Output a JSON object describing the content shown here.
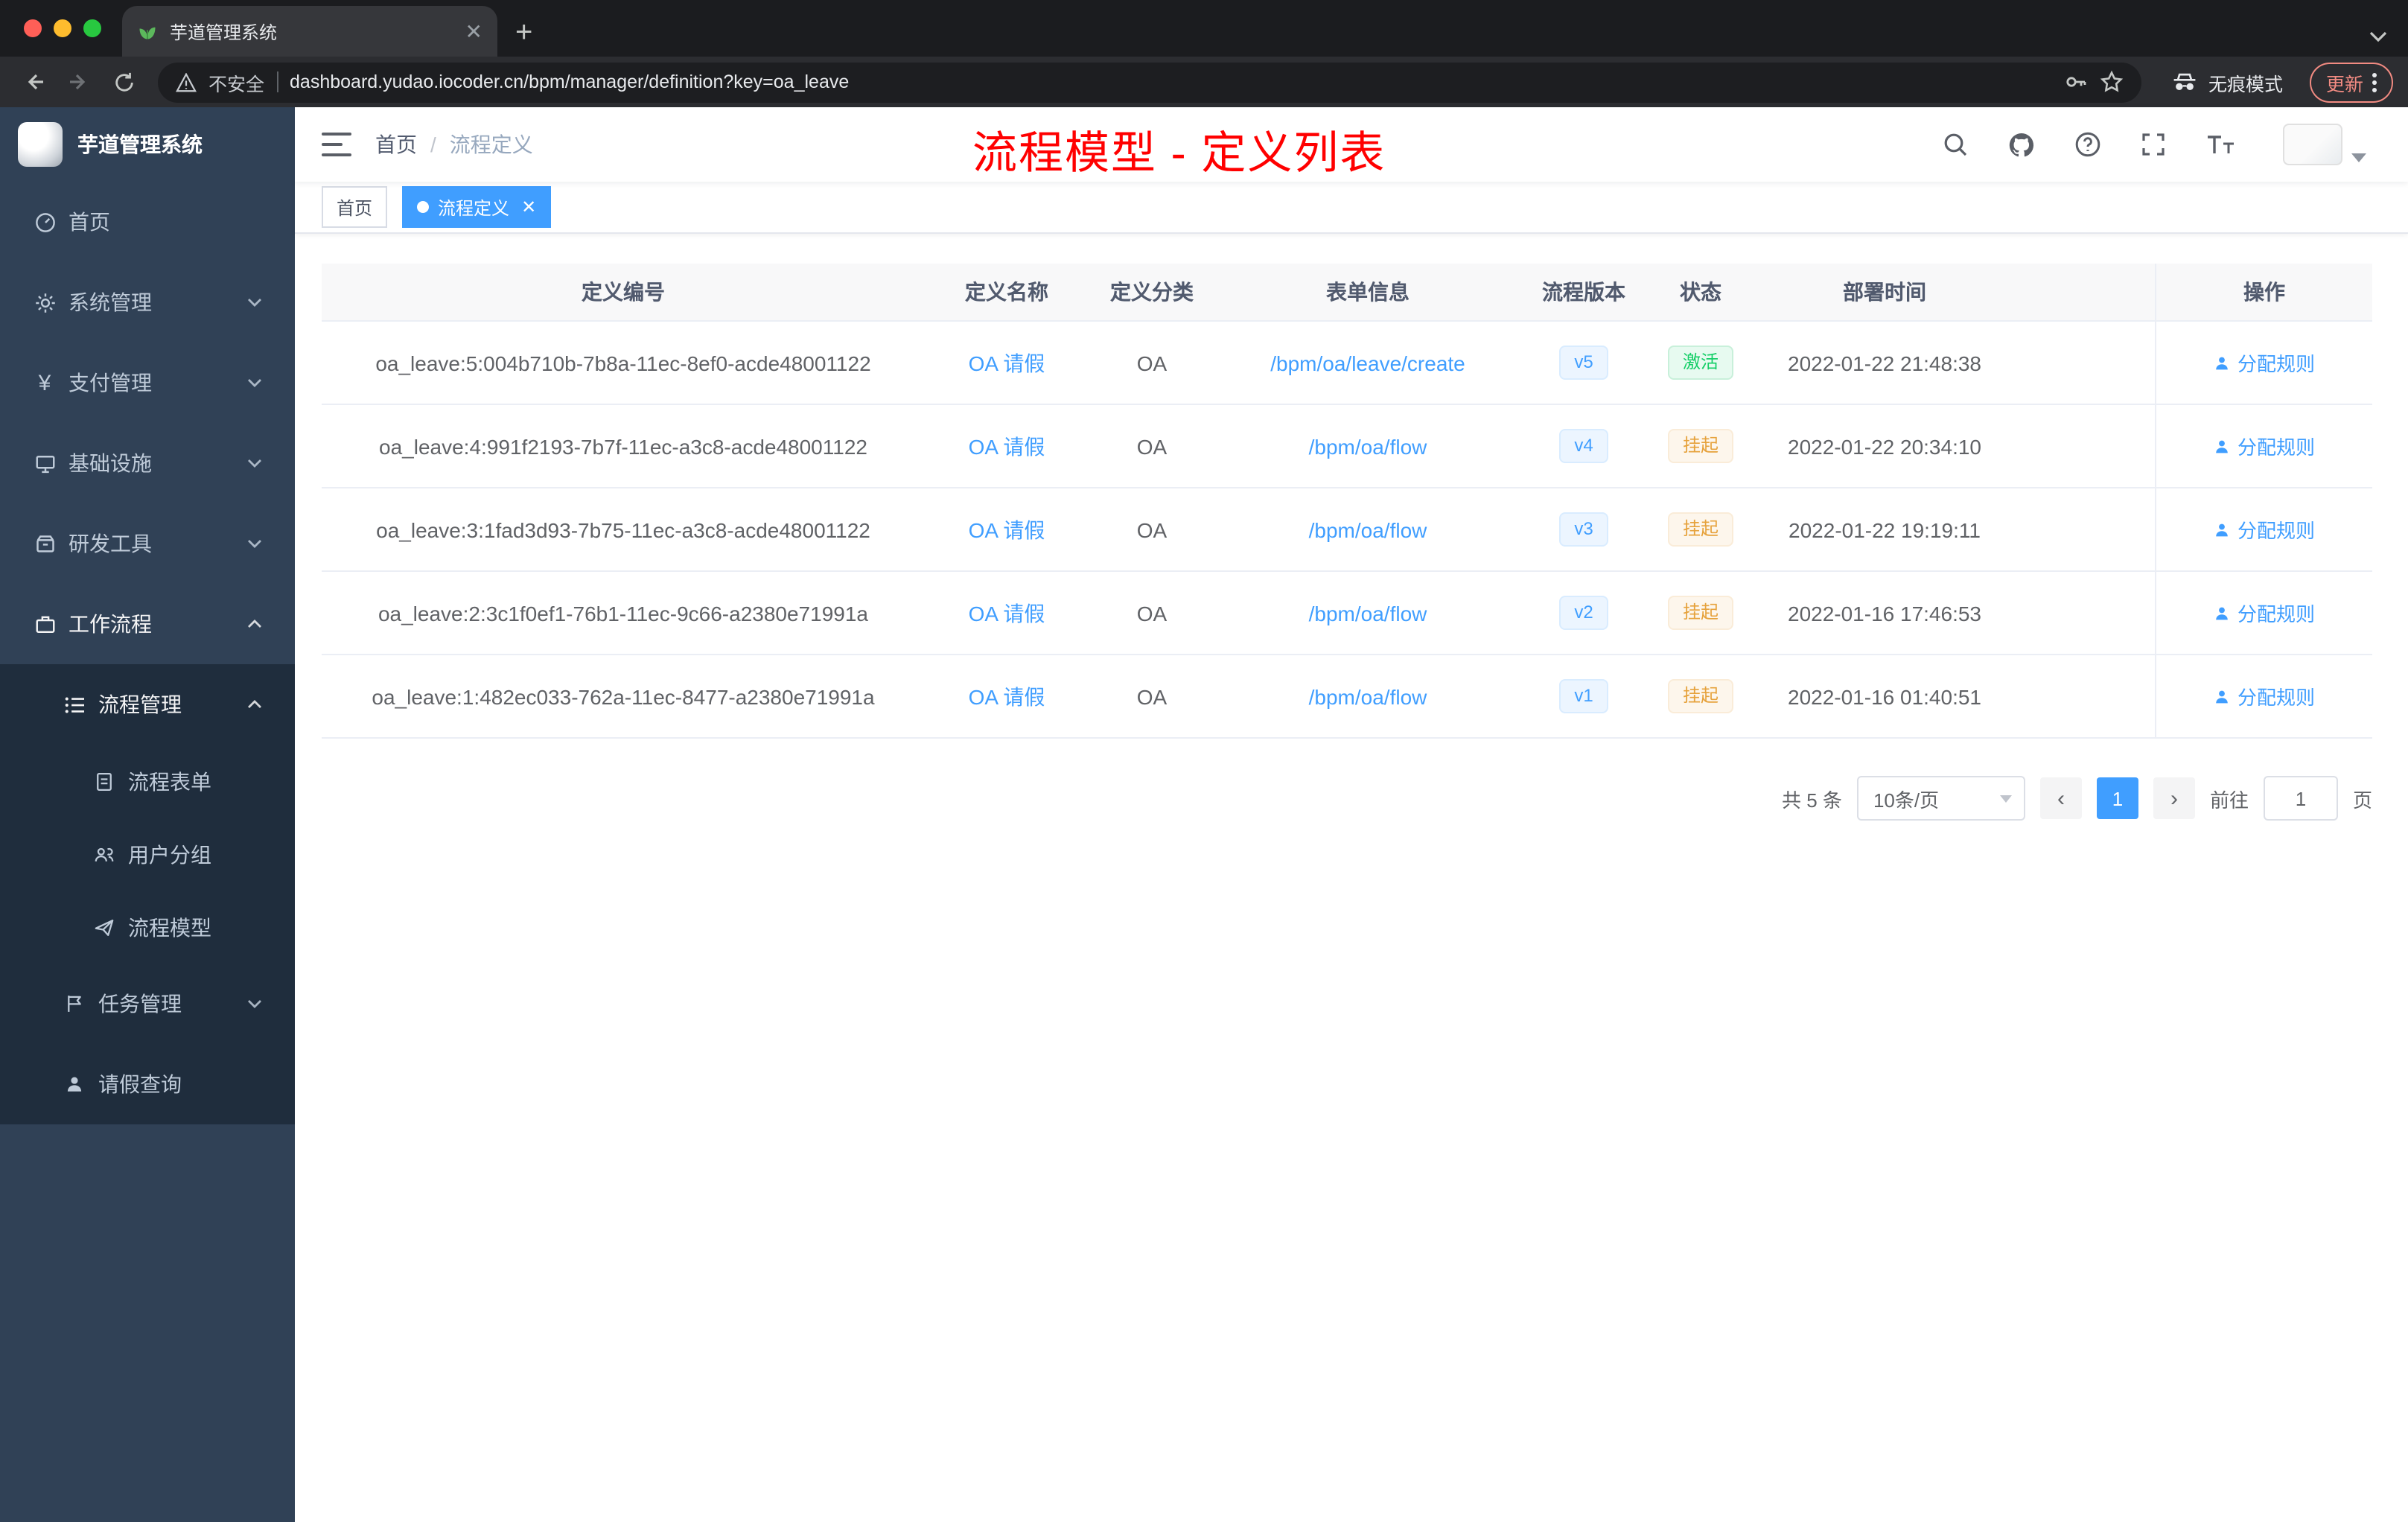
{
  "colors": {
    "accent": "#409eff",
    "annotation_red": "#ff0000",
    "sidebar_bg": "#304156",
    "submenu_bg": "#1f2d3d",
    "status_active_green": "#13ce66",
    "status_suspend_orange": "#e6a23c",
    "active_tab_blue": "#409eff"
  },
  "browser": {
    "tab_title": "芋道管理系统",
    "security_label": "不安全",
    "url": "dashboard.yudao.iocoder.cn/bpm/manager/definition?key=oa_leave",
    "incognito_label": "无痕模式",
    "update_label": "更新"
  },
  "sidebar": {
    "logo_title": "芋道管理系统",
    "items": [
      {
        "label": "首页"
      },
      {
        "label": "系统管理"
      },
      {
        "label": "支付管理"
      },
      {
        "label": "基础设施"
      },
      {
        "label": "研发工具"
      },
      {
        "label": "工作流程"
      },
      {
        "label": "流程管理"
      },
      {
        "label": "流程表单"
      },
      {
        "label": "用户分组"
      },
      {
        "label": "流程模型"
      },
      {
        "label": "任务管理"
      },
      {
        "label": "请假查询"
      }
    ]
  },
  "header": {
    "breadcrumb": {
      "home": "首页",
      "separator": "/",
      "current": "流程定义"
    },
    "annotation": "流程模型 - 定义列表"
  },
  "tags": {
    "home": "首页",
    "active": "流程定义"
  },
  "table": {
    "columns": [
      "定义编号",
      "定义名称",
      "定义分类",
      "表单信息",
      "流程版本",
      "状态",
      "部署时间",
      "操作"
    ],
    "action_label": "分配规则",
    "rows": [
      {
        "id": "oa_leave:5:004b710b-7b8a-11ec-8ef0-acde48001122",
        "name": "OA 请假",
        "category": "OA",
        "form": "/bpm/oa/leave/create",
        "version": "v5",
        "status": "激活",
        "time": "2022-01-22 21:48:38"
      },
      {
        "id": "oa_leave:4:991f2193-7b7f-11ec-a3c8-acde48001122",
        "name": "OA 请假",
        "category": "OA",
        "form": "/bpm/oa/flow",
        "version": "v4",
        "status": "挂起",
        "time": "2022-01-22 20:34:10"
      },
      {
        "id": "oa_leave:3:1fad3d93-7b75-11ec-a3c8-acde48001122",
        "name": "OA 请假",
        "category": "OA",
        "form": "/bpm/oa/flow",
        "version": "v3",
        "status": "挂起",
        "time": "2022-01-22 19:19:11"
      },
      {
        "id": "oa_leave:2:3c1f0ef1-76b1-11ec-9c66-a2380e71991a",
        "name": "OA 请假",
        "category": "OA",
        "form": "/bpm/oa/flow",
        "version": "v2",
        "status": "挂起",
        "time": "2022-01-16 17:46:53"
      },
      {
        "id": "oa_leave:1:482ec033-762a-11ec-8477-a2380e71991a",
        "name": "OA 请假",
        "category": "OA",
        "form": "/bpm/oa/flow",
        "version": "v1",
        "status": "挂起",
        "time": "2022-01-16 01:40:51"
      }
    ]
  },
  "pagination": {
    "total_label": "共 5 条",
    "page_size_label": "10条/页",
    "prev": "‹",
    "page": "1",
    "next": "›",
    "goto_label": "前往",
    "goto_value": "1",
    "page_unit": "页"
  }
}
